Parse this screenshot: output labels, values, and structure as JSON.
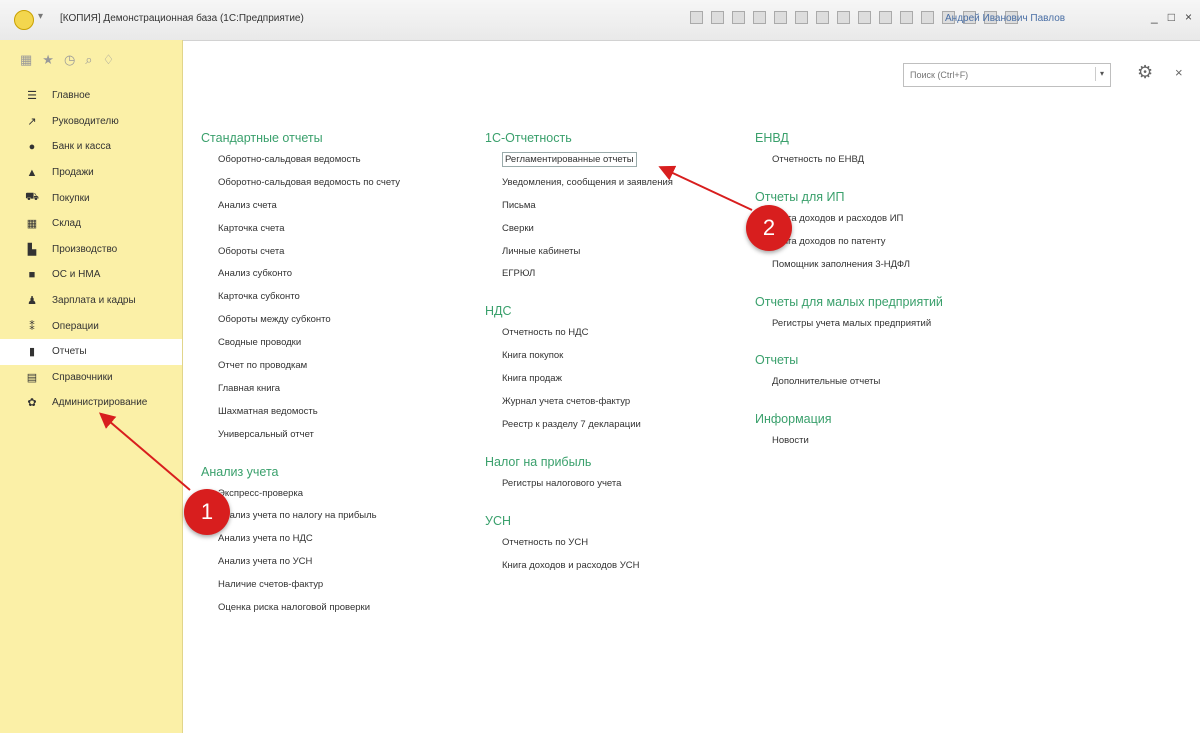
{
  "window": {
    "title": "[КОПИЯ] Демонстрационная база (1С:Предприятие)",
    "user": "Андрей Иванович Павлов"
  },
  "search": {
    "placeholder": "Поиск (Ctrl+F)"
  },
  "sidebar": {
    "items": [
      {
        "label": "Главное",
        "icon": "menu-icon"
      },
      {
        "label": "Руководителю",
        "icon": "chart-line-icon"
      },
      {
        "label": "Банк и касса",
        "icon": "coin-icon"
      },
      {
        "label": "Продажи",
        "icon": "bag-icon"
      },
      {
        "label": "Покупки",
        "icon": "cart-icon"
      },
      {
        "label": "Склад",
        "icon": "warehouse-icon"
      },
      {
        "label": "Производство",
        "icon": "factory-icon"
      },
      {
        "label": "ОС и НМА",
        "icon": "truck-icon"
      },
      {
        "label": "Зарплата и кадры",
        "icon": "person-icon"
      },
      {
        "label": "Операции",
        "icon": "operations-icon"
      },
      {
        "label": "Отчеты",
        "icon": "bar-chart-icon",
        "active": true
      },
      {
        "label": "Справочники",
        "icon": "book-icon"
      },
      {
        "label": "Администрирование",
        "icon": "gear-icon"
      }
    ]
  },
  "columns": {
    "col1": {
      "sections": [
        {
          "title": "Стандартные отчеты",
          "items": [
            "Оборотно-сальдовая ведомость",
            "Оборотно-сальдовая ведомость по счету",
            "Анализ счета",
            "Карточка счета",
            "Обороты счета",
            "Анализ субконто",
            "Карточка субконто",
            "Обороты между субконто",
            "Сводные проводки",
            "Отчет по проводкам",
            "Главная книга",
            "Шахматная ведомость",
            "Универсальный отчет"
          ]
        },
        {
          "title": "Анализ учета",
          "items": [
            "Экспресс-проверка",
            "Анализ учета по налогу на прибыль",
            "Анализ учета по НДС",
            "Анализ учета по УСН",
            "Наличие счетов-фактур",
            "Оценка риска налоговой проверки"
          ]
        }
      ]
    },
    "col2": {
      "sections": [
        {
          "title": "1С-Отчетность",
          "items": [
            "Регламентированные отчеты",
            "Уведомления, сообщения и заявления",
            "Письма",
            "Сверки",
            "Личные кабинеты",
            "ЕГРЮЛ"
          ]
        },
        {
          "title": "НДС",
          "items": [
            "Отчетность по НДС",
            "Книга покупок",
            "Книга продаж",
            "Журнал учета счетов-фактур",
            "Реестр к разделу 7 декларации"
          ]
        },
        {
          "title": "Налог на прибыль",
          "items": [
            "Регистры налогового учета"
          ]
        },
        {
          "title": "УСН",
          "items": [
            "Отчетность по УСН",
            "Книга доходов и расходов УСН"
          ]
        }
      ]
    },
    "col3": {
      "sections": [
        {
          "title": "ЕНВД",
          "items": [
            "Отчетность по ЕНВД"
          ]
        },
        {
          "title": "Отчеты для ИП",
          "items": [
            "Книга доходов и расходов ИП",
            "Книга доходов по патенту",
            "Помощник заполнения 3-НДФЛ"
          ]
        },
        {
          "title": "Отчеты для малых предприятий",
          "items": [
            "Регистры учета малых предприятий"
          ]
        },
        {
          "title": "Отчеты",
          "items": [
            "Дополнительные отчеты"
          ]
        },
        {
          "title": "Информация",
          "items": [
            "Новости"
          ]
        }
      ]
    }
  },
  "annotations": [
    {
      "label": "1"
    },
    {
      "label": "2"
    }
  ],
  "colors": {
    "sidebar": "#fbf0a7",
    "section_title": "#3aa06c",
    "marker": "#d81e1e"
  }
}
